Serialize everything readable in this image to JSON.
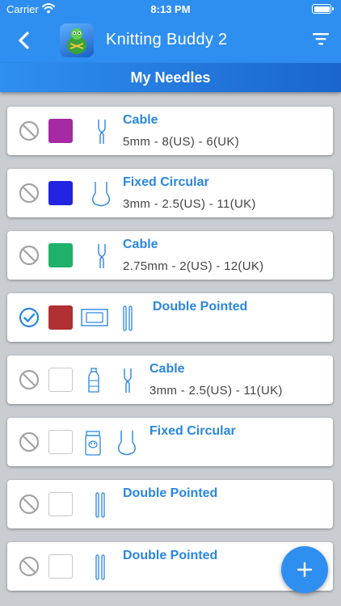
{
  "status_bar": {
    "carrier": "Carrier",
    "time": "8:13 PM"
  },
  "nav": {
    "title": "Knitting Buddy 2",
    "back_icon": "chevron-left-icon",
    "filter_icon": "filter-icon"
  },
  "section": {
    "title": "My Needles"
  },
  "colors": {
    "accent": "#2f8ff0",
    "label_blue": "#2a86e0"
  },
  "needles": [
    {
      "status": "unavailable",
      "swatch": "#a52aa3",
      "extra_icon": "",
      "type_icon": "cable-needle-icon",
      "name": "Cable",
      "size": "5mm - 8(US) - 6(UK)"
    },
    {
      "status": "unavailable",
      "swatch": "#2323e3",
      "extra_icon": "",
      "type_icon": "fixed-circular-needle-icon",
      "name": "Fixed Circular",
      "size": "3mm - 2.5(US) - 11(UK)"
    },
    {
      "status": "unavailable",
      "swatch": "#1fb16a",
      "extra_icon": "",
      "type_icon": "cable-needle-icon",
      "name": "Cable",
      "size": "2.75mm - 2(US) - 12(UK)"
    },
    {
      "status": "selected",
      "swatch": "#b03033",
      "extra_icon": "needle-case-icon",
      "type_icon": "double-pointed-needle-icon",
      "name": "Double Pointed",
      "size": ""
    },
    {
      "status": "unavailable",
      "swatch": "",
      "extra_icon": "bottle-icon",
      "type_icon": "cable-needle-icon",
      "name": "Cable",
      "size": "3mm - 2.5(US) - 11(UK)"
    },
    {
      "status": "unavailable",
      "swatch": "",
      "extra_icon": "jar-icon",
      "type_icon": "fixed-circular-needle-icon",
      "name": "Fixed Circular",
      "size": ""
    },
    {
      "status": "unavailable",
      "swatch": "",
      "extra_icon": "",
      "type_icon": "double-pointed-needle-icon",
      "name": "Double Pointed",
      "size": ""
    },
    {
      "status": "unavailable",
      "swatch": "",
      "extra_icon": "",
      "type_icon": "double-pointed-needle-icon",
      "name": "Double Pointed",
      "size": ""
    }
  ],
  "fab": {
    "icon": "plus-icon"
  }
}
